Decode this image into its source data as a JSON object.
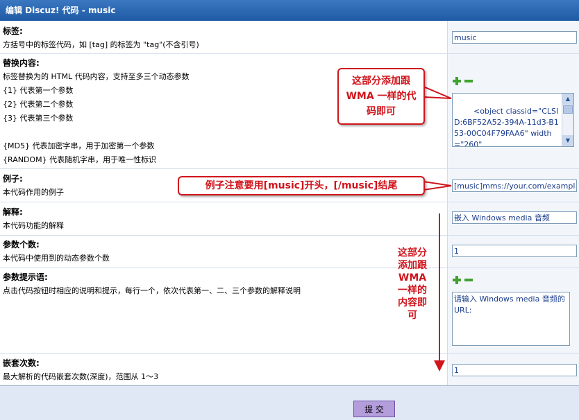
{
  "window": {
    "title": "编辑 Discuz! 代码 - music"
  },
  "rows": {
    "tag": {
      "label": "标签:",
      "desc": "方括号中的标签代码，如 [tag] 的标签为 \"tag\"(不含引号)",
      "value": "music"
    },
    "replace": {
      "label": "替换内容:",
      "lines": [
        "标签替换为的 HTML 代码内容，支持至多三个动态参数",
        "{1} 代表第一个参数",
        "{2} 代表第二个参数",
        "{3} 代表第三个参数",
        "{MD5} 代表加密字串，用于加密第一个参数",
        "{RANDOM} 代表随机字串，用于唯一性标识"
      ],
      "value": "<object classid=\"CLSID:6BF52A52-394A-11d3-B153-00C04F79FAA6\" width=\"260\""
    },
    "example": {
      "label": "例子:",
      "desc": "本代码作用的例子",
      "value": "[music]mms://your.com/example"
    },
    "explain": {
      "label": "解释:",
      "desc": "本代码功能的解释",
      "value": "嵌入 Windows media 音频"
    },
    "params": {
      "label": "参数个数:",
      "desc": "本代码中使用到的动态参数个数",
      "value": "1"
    },
    "prompt": {
      "label": "参数提示语:",
      "desc": "点击代码按钮时相应的说明和提示，每行一个，依次代表第一、二、三个参数的解释说明",
      "value": "请输入 Windows media 音频的 URL:"
    },
    "nest": {
      "label": "嵌套次数:",
      "desc": "最大解析的代码嵌套次数(深度)，范围从 1～3",
      "value": "1"
    }
  },
  "annotations": {
    "a1": [
      "这部分添加跟",
      "WMA 一样的代",
      "码即可"
    ],
    "a2": "例子注意要用[music]开头，[/music]结尾",
    "a3": [
      "这部分",
      "添加跟",
      "WMA",
      "一样的",
      "内容即",
      "可"
    ]
  },
  "submit_label": "提 交"
}
